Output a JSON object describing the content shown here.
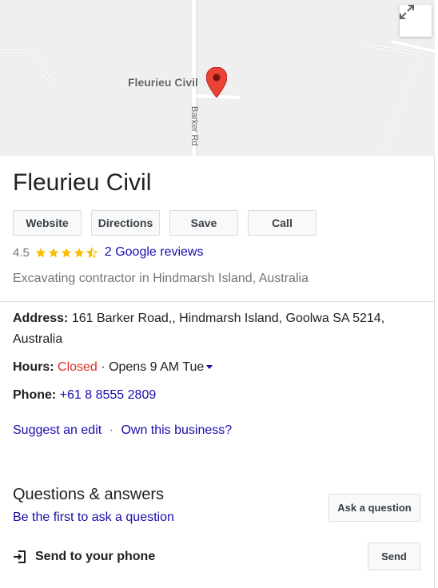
{
  "map": {
    "place_label": "Fleurieu Civil",
    "road_label": "Barker Rd"
  },
  "business": {
    "name": "Fleurieu Civil",
    "rating": "4.5",
    "reviews_label": "2 Google reviews",
    "category": "Excavating contractor in Hindmarsh Island, Australia"
  },
  "actions": {
    "website": "Website",
    "directions": "Directions",
    "save": "Save",
    "call": "Call"
  },
  "info": {
    "address_label": "Address:",
    "address_value": "161 Barker Road,, Hindmarsh Island, Goolwa SA 5214, Australia",
    "hours_label": "Hours:",
    "hours_status": "Closed",
    "hours_separator": "·",
    "hours_next": "Opens 9 AM Tue",
    "phone_label": "Phone:",
    "phone_value": "+61 8 8555 2809"
  },
  "links": {
    "suggest_edit": "Suggest an edit",
    "separator": "·",
    "own_business": "Own this business?"
  },
  "qa": {
    "title": "Questions & answers",
    "first_ask": "Be the first to ask a question",
    "ask_button": "Ask a question"
  },
  "send": {
    "label": "Send to your phone",
    "button": "Send"
  },
  "colors": {
    "link": "#1a0dab",
    "closed": "#d93025",
    "star": "#fbbc04",
    "pin": "#ea4335"
  },
  "icons": {
    "expand": "expand-icon",
    "pin": "map-pin-icon",
    "star": "star-icon",
    "send": "send-to-phone-icon"
  }
}
